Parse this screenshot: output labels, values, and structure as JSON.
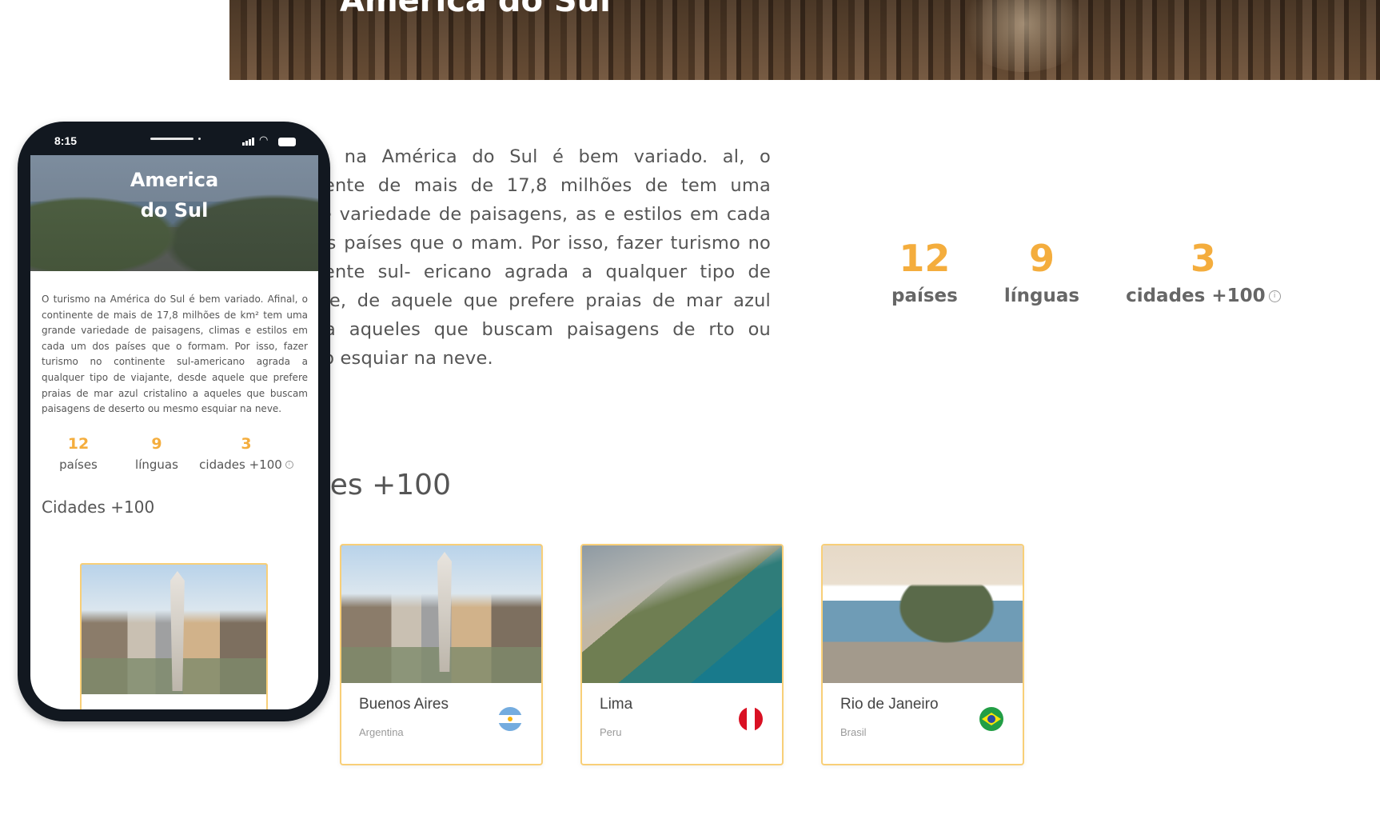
{
  "desktop": {
    "hero_title": "America do Sul",
    "intro": "urismo na América do Sul é bem variado. al, o continente de mais de 17,8 milhões de tem uma grande variedade de paisagens, as e estilos em cada um dos países que o mam. Por isso, fazer turismo no continente sul- ericano agrada a qualquer tipo de viajante, de aquele que prefere praias de mar azul alino a aqueles que buscam paisagens de rto ou mesmo esquiar na neve.",
    "stats": [
      {
        "value": "12",
        "label": "países"
      },
      {
        "value": "9",
        "label": "línguas"
      },
      {
        "value": "3",
        "label": "cidades +100"
      }
    ],
    "cities_heading": "dades +100",
    "cards": [
      {
        "city": "Buenos Aires",
        "country": "Argentina",
        "flag": "argentina-flag-icon"
      },
      {
        "city": "Lima",
        "country": "Peru",
        "flag": "peru-flag-icon"
      },
      {
        "city": "Rio de Janeiro",
        "country": "Brasil",
        "flag": "brazil-flag-icon"
      }
    ]
  },
  "mobile": {
    "time": "8:15",
    "hero_title_line1": "America",
    "hero_title_line2": "do Sul",
    "intro": "O turismo na América do Sul é bem variado. Afinal, o continente de mais de 17,8 milhões de km² tem uma grande variedade de paisagens, climas e estilos em cada um dos países que o formam. Por isso, fazer turismo no continente sul-americano agrada a qualquer tipo de viajante, desde aquele que prefere praias de mar azul cristalino a aqueles que buscam paisagens de deserto ou mesmo esquiar na neve.",
    "stats": [
      {
        "value": "12",
        "label": "países"
      },
      {
        "value": "9",
        "label": "línguas"
      },
      {
        "value": "3",
        "label": "cidades +100"
      }
    ],
    "cities_heading": "Cidades +100"
  },
  "colors": {
    "accent": "#f4ad3d",
    "card_border": "#f8cf78",
    "text": "#555555"
  }
}
